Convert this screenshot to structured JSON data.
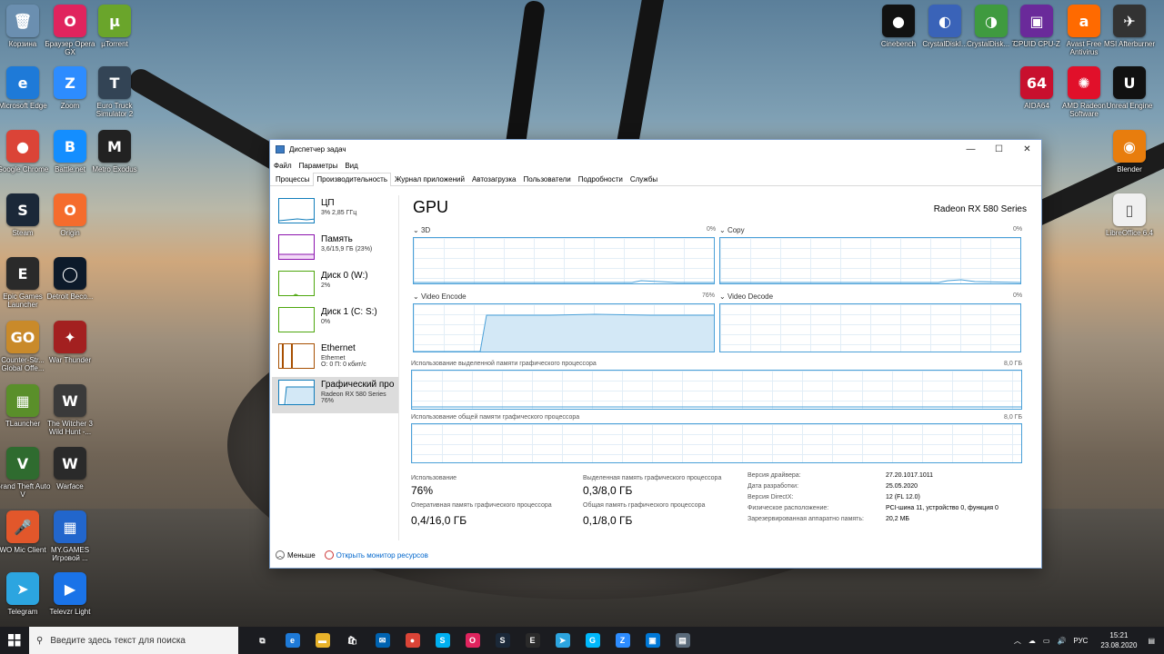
{
  "desktop": {
    "icons_left": [
      {
        "label": "Корзина",
        "icon": "recycle-bin-icon",
        "color": "#6b8fb0",
        "glyph": "🗑"
      },
      {
        "label": "Браузер Opera GX",
        "icon": "opera-icon",
        "color": "#e0245e",
        "glyph": "O"
      },
      {
        "label": "µTorrent",
        "icon": "utorrent-icon",
        "color": "#6aa52b",
        "glyph": "µ"
      },
      {
        "label": "Microsoft Edge",
        "icon": "edge-icon",
        "color": "#1e7ad8",
        "glyph": "e"
      },
      {
        "label": "Zoom",
        "icon": "zoom-icon",
        "color": "#2d8cff",
        "glyph": "Z"
      },
      {
        "label": "Euro Truck Simulator 2",
        "icon": "ets2-icon",
        "color": "#334455",
        "glyph": "T"
      },
      {
        "label": "Google Chrome",
        "icon": "chrome-icon",
        "color": "#db4437",
        "glyph": "●"
      },
      {
        "label": "Battle.net",
        "icon": "battlenet-icon",
        "color": "#148eff",
        "glyph": "B"
      },
      {
        "label": "Metro Exodus",
        "icon": "metro-icon",
        "color": "#222222",
        "glyph": "M"
      },
      {
        "label": "Steam",
        "icon": "steam-icon",
        "color": "#1b2838",
        "glyph": "S"
      },
      {
        "label": "Origin",
        "icon": "origin-icon",
        "color": "#f56c2d",
        "glyph": "O"
      },
      {
        "label": "Epic Games Launcher",
        "icon": "epic-games-icon",
        "color": "#2a2a2a",
        "glyph": "E"
      },
      {
        "label": "Detroit Beco...",
        "icon": "detroit-icon",
        "color": "#0d1a2a",
        "glyph": "◯"
      },
      {
        "label": "Counter-Str... Global Offe...",
        "icon": "csgo-icon",
        "color": "#c98a2a",
        "glyph": "GO"
      },
      {
        "label": "War Thunder",
        "icon": "war-thunder-icon",
        "color": "#a32020",
        "glyph": "✦"
      },
      {
        "label": "TLauncher",
        "icon": "tlauncher-icon",
        "color": "#5a8f2a",
        "glyph": "▦"
      },
      {
        "label": "The Witcher 3 Wild Hunt -...",
        "icon": "witcher-icon",
        "color": "#3a3a3a",
        "glyph": "W"
      },
      {
        "label": "Grand Theft Auto V",
        "icon": "gta-icon",
        "color": "#2f6b2f",
        "glyph": "V"
      },
      {
        "label": "Warface",
        "icon": "warface-icon",
        "color": "#2a2a2a",
        "glyph": "W"
      },
      {
        "label": "WO Mic Client",
        "icon": "wo-mic-icon",
        "color": "#e2572b",
        "glyph": "🎤"
      },
      {
        "label": "MY.GAMES Игровой ...",
        "icon": "mygames-icon",
        "color": "#2266cc",
        "glyph": "▦"
      },
      {
        "label": "Telegram",
        "icon": "telegram-icon",
        "color": "#2ca5e0",
        "glyph": "➤"
      },
      {
        "label": "Televzr Light",
        "icon": "televzr-icon",
        "color": "#1a73e8",
        "glyph": "▶"
      }
    ],
    "icons_right": [
      {
        "label": "Cinebench",
        "icon": "cinebench-icon",
        "color": "#111111",
        "glyph": "●"
      },
      {
        "label": "CrystalDiskI...",
        "icon": "crystaldiskinfo-icon",
        "color": "#3a63b8",
        "glyph": "◐"
      },
      {
        "label": "CrystalDisk... 7",
        "icon": "crystaldiskmark-icon",
        "color": "#3f9a3f",
        "glyph": "◑"
      },
      {
        "label": "CPUID CPU-Z",
        "icon": "cpuz-icon",
        "color": "#6a2a9a",
        "glyph": "▣"
      },
      {
        "label": "Avast Free Antivirus",
        "icon": "avast-icon",
        "color": "#ff6a00",
        "glyph": "a"
      },
      {
        "label": "MSI Afterburner",
        "icon": "afterburner-icon",
        "color": "#333333",
        "glyph": "✈"
      },
      {
        "label": "AIDA64",
        "icon": "aida64-icon",
        "color": "#c8102e",
        "glyph": "64"
      },
      {
        "label": "AMD Radeon Software",
        "icon": "amd-radeon-icon",
        "color": "#e1102a",
        "glyph": "✺"
      },
      {
        "label": "Unreal Engine",
        "icon": "unreal-icon",
        "color": "#111111",
        "glyph": "U"
      },
      {
        "label": "Blender",
        "icon": "blender-icon",
        "color": "#e87d0d",
        "glyph": "◉"
      },
      {
        "label": "LibreOffice 6.4",
        "icon": "libreoffice-icon",
        "color": "#f0f0f0",
        "glyph": "▯"
      }
    ]
  },
  "window": {
    "title": "Диспетчер задач",
    "menu": [
      "Файл",
      "Параметры",
      "Вид"
    ],
    "tabs": [
      "Процессы",
      "Производительность",
      "Журнал приложений",
      "Автозагрузка",
      "Пользователи",
      "Подробности",
      "Службы"
    ],
    "active_tab": 1,
    "sidebar": [
      {
        "title": "ЦП",
        "line2": "3% 2,85 ГГц",
        "line3": "",
        "color": "#117dbb"
      },
      {
        "title": "Память",
        "line2": "3,6/15,9 ГБ (23%)",
        "line3": "",
        "color": "#8b12ae"
      },
      {
        "title": "Диск 0 (W:)",
        "line2": "2%",
        "line3": "",
        "color": "#4da60c"
      },
      {
        "title": "Диск 1 (C: S:)",
        "line2": "0%",
        "line3": "",
        "color": "#4da60c"
      },
      {
        "title": "Ethernet",
        "line2": "Ethernet",
        "line3": "О: 0 П: 0 кбит/с",
        "color": "#a74f01"
      },
      {
        "title": "Графический про",
        "line2": "Radeon RX 580 Series",
        "line3": "76%",
        "color": "#117dbb"
      }
    ],
    "gpu": {
      "title": "GPU",
      "model": "Radeon RX 580 Series",
      "engines": [
        {
          "name": "3D",
          "pct": "0%"
        },
        {
          "name": "Copy",
          "pct": "0%"
        },
        {
          "name": "Video Encode",
          "pct": "76%"
        },
        {
          "name": "Video Decode",
          "pct": "0%"
        }
      ],
      "dedicated_label": "Использование выделенной памяти графического процессора",
      "dedicated_max": "8,0 ГБ",
      "shared_label": "Использование общей памяти графического процессора",
      "shared_max": "8,0 ГБ",
      "stats": {
        "usage_label": "Использование",
        "usage_value": "76%",
        "dedicated_label": "Выделенная память графического процессора",
        "dedicated_value": "0,3/8,0 ГБ",
        "gpu_ram_label": "Оперативная память графического процессора",
        "gpu_ram_value": "0,4/16,0 ГБ",
        "shared_label": "Общая память графического процессора",
        "shared_value": "0,1/8,0 ГБ"
      },
      "info": [
        {
          "k": "Версия драйвера:",
          "v": "27.20.1017.1011"
        },
        {
          "k": "Дата разработки:",
          "v": "25.05.2020"
        },
        {
          "k": "Версия DirectX:",
          "v": "12 (FL 12.0)"
        },
        {
          "k": "Физическое расположение:",
          "v": "PCI-шина 11, устройство 0, функция 0"
        },
        {
          "k": "Зарезервированная аппаратно память:",
          "v": "20,2 МБ"
        }
      ]
    },
    "footer": {
      "less": "Меньше",
      "monitor": "Открыть монитор ресурсов"
    }
  },
  "taskbar": {
    "search_placeholder": "Введите здесь текст для поиска",
    "apps": [
      {
        "icon": "task-view-icon",
        "glyph": "⧉",
        "color": "#1b1c20"
      },
      {
        "icon": "edge-icon",
        "glyph": "e",
        "color": "#1e7ad8"
      },
      {
        "icon": "file-explorer-icon",
        "glyph": "▬",
        "color": "#e8b22a"
      },
      {
        "icon": "store-icon",
        "glyph": "🛍",
        "color": "#1b1c20"
      },
      {
        "icon": "mail-icon",
        "glyph": "✉",
        "color": "#0063b1"
      },
      {
        "icon": "chrome-icon",
        "glyph": "●",
        "color": "#db4437"
      },
      {
        "icon": "skype-icon",
        "glyph": "S",
        "color": "#00aff0"
      },
      {
        "icon": "opera-icon",
        "glyph": "O",
        "color": "#e0245e"
      },
      {
        "icon": "steam-icon",
        "glyph": "S",
        "color": "#1b2838"
      },
      {
        "icon": "epic-games-icon",
        "glyph": "E",
        "color": "#2a2a2a"
      },
      {
        "icon": "telegram-icon",
        "glyph": "➤",
        "color": "#2ca5e0"
      },
      {
        "icon": "logitech-icon",
        "glyph": "G",
        "color": "#00b8fc"
      },
      {
        "icon": "zoom-icon",
        "glyph": "Z",
        "color": "#2d8cff"
      },
      {
        "icon": "photos-icon",
        "glyph": "▣",
        "color": "#0078d7"
      },
      {
        "icon": "task-manager-icon",
        "glyph": "▤",
        "color": "#5a6a7a"
      }
    ],
    "lang": "РУС",
    "time": "15:21",
    "date": "23.08.2020"
  }
}
